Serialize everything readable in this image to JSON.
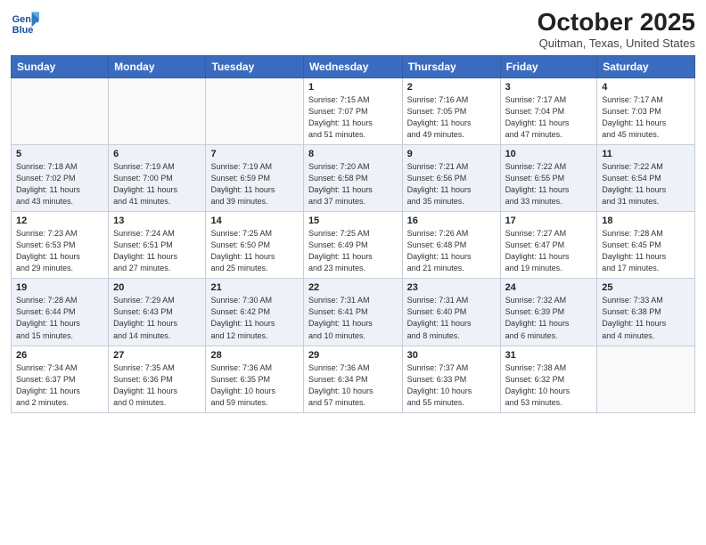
{
  "header": {
    "logo_line1": "General",
    "logo_line2": "Blue",
    "month": "October 2025",
    "location": "Quitman, Texas, United States"
  },
  "days_of_week": [
    "Sunday",
    "Monday",
    "Tuesday",
    "Wednesday",
    "Thursday",
    "Friday",
    "Saturday"
  ],
  "weeks": [
    [
      {
        "num": "",
        "info": ""
      },
      {
        "num": "",
        "info": ""
      },
      {
        "num": "",
        "info": ""
      },
      {
        "num": "1",
        "info": "Sunrise: 7:15 AM\nSunset: 7:07 PM\nDaylight: 11 hours\nand 51 minutes."
      },
      {
        "num": "2",
        "info": "Sunrise: 7:16 AM\nSunset: 7:05 PM\nDaylight: 11 hours\nand 49 minutes."
      },
      {
        "num": "3",
        "info": "Sunrise: 7:17 AM\nSunset: 7:04 PM\nDaylight: 11 hours\nand 47 minutes."
      },
      {
        "num": "4",
        "info": "Sunrise: 7:17 AM\nSunset: 7:03 PM\nDaylight: 11 hours\nand 45 minutes."
      }
    ],
    [
      {
        "num": "5",
        "info": "Sunrise: 7:18 AM\nSunset: 7:02 PM\nDaylight: 11 hours\nand 43 minutes."
      },
      {
        "num": "6",
        "info": "Sunrise: 7:19 AM\nSunset: 7:00 PM\nDaylight: 11 hours\nand 41 minutes."
      },
      {
        "num": "7",
        "info": "Sunrise: 7:19 AM\nSunset: 6:59 PM\nDaylight: 11 hours\nand 39 minutes."
      },
      {
        "num": "8",
        "info": "Sunrise: 7:20 AM\nSunset: 6:58 PM\nDaylight: 11 hours\nand 37 minutes."
      },
      {
        "num": "9",
        "info": "Sunrise: 7:21 AM\nSunset: 6:56 PM\nDaylight: 11 hours\nand 35 minutes."
      },
      {
        "num": "10",
        "info": "Sunrise: 7:22 AM\nSunset: 6:55 PM\nDaylight: 11 hours\nand 33 minutes."
      },
      {
        "num": "11",
        "info": "Sunrise: 7:22 AM\nSunset: 6:54 PM\nDaylight: 11 hours\nand 31 minutes."
      }
    ],
    [
      {
        "num": "12",
        "info": "Sunrise: 7:23 AM\nSunset: 6:53 PM\nDaylight: 11 hours\nand 29 minutes."
      },
      {
        "num": "13",
        "info": "Sunrise: 7:24 AM\nSunset: 6:51 PM\nDaylight: 11 hours\nand 27 minutes."
      },
      {
        "num": "14",
        "info": "Sunrise: 7:25 AM\nSunset: 6:50 PM\nDaylight: 11 hours\nand 25 minutes."
      },
      {
        "num": "15",
        "info": "Sunrise: 7:25 AM\nSunset: 6:49 PM\nDaylight: 11 hours\nand 23 minutes."
      },
      {
        "num": "16",
        "info": "Sunrise: 7:26 AM\nSunset: 6:48 PM\nDaylight: 11 hours\nand 21 minutes."
      },
      {
        "num": "17",
        "info": "Sunrise: 7:27 AM\nSunset: 6:47 PM\nDaylight: 11 hours\nand 19 minutes."
      },
      {
        "num": "18",
        "info": "Sunrise: 7:28 AM\nSunset: 6:45 PM\nDaylight: 11 hours\nand 17 minutes."
      }
    ],
    [
      {
        "num": "19",
        "info": "Sunrise: 7:28 AM\nSunset: 6:44 PM\nDaylight: 11 hours\nand 15 minutes."
      },
      {
        "num": "20",
        "info": "Sunrise: 7:29 AM\nSunset: 6:43 PM\nDaylight: 11 hours\nand 14 minutes."
      },
      {
        "num": "21",
        "info": "Sunrise: 7:30 AM\nSunset: 6:42 PM\nDaylight: 11 hours\nand 12 minutes."
      },
      {
        "num": "22",
        "info": "Sunrise: 7:31 AM\nSunset: 6:41 PM\nDaylight: 11 hours\nand 10 minutes."
      },
      {
        "num": "23",
        "info": "Sunrise: 7:31 AM\nSunset: 6:40 PM\nDaylight: 11 hours\nand 8 minutes."
      },
      {
        "num": "24",
        "info": "Sunrise: 7:32 AM\nSunset: 6:39 PM\nDaylight: 11 hours\nand 6 minutes."
      },
      {
        "num": "25",
        "info": "Sunrise: 7:33 AM\nSunset: 6:38 PM\nDaylight: 11 hours\nand 4 minutes."
      }
    ],
    [
      {
        "num": "26",
        "info": "Sunrise: 7:34 AM\nSunset: 6:37 PM\nDaylight: 11 hours\nand 2 minutes."
      },
      {
        "num": "27",
        "info": "Sunrise: 7:35 AM\nSunset: 6:36 PM\nDaylight: 11 hours\nand 0 minutes."
      },
      {
        "num": "28",
        "info": "Sunrise: 7:36 AM\nSunset: 6:35 PM\nDaylight: 10 hours\nand 59 minutes."
      },
      {
        "num": "29",
        "info": "Sunrise: 7:36 AM\nSunset: 6:34 PM\nDaylight: 10 hours\nand 57 minutes."
      },
      {
        "num": "30",
        "info": "Sunrise: 7:37 AM\nSunset: 6:33 PM\nDaylight: 10 hours\nand 55 minutes."
      },
      {
        "num": "31",
        "info": "Sunrise: 7:38 AM\nSunset: 6:32 PM\nDaylight: 10 hours\nand 53 minutes."
      },
      {
        "num": "",
        "info": ""
      }
    ]
  ],
  "row_bg": [
    "#ffffff",
    "#eef1f7",
    "#ffffff",
    "#eef1f7",
    "#ffffff"
  ]
}
